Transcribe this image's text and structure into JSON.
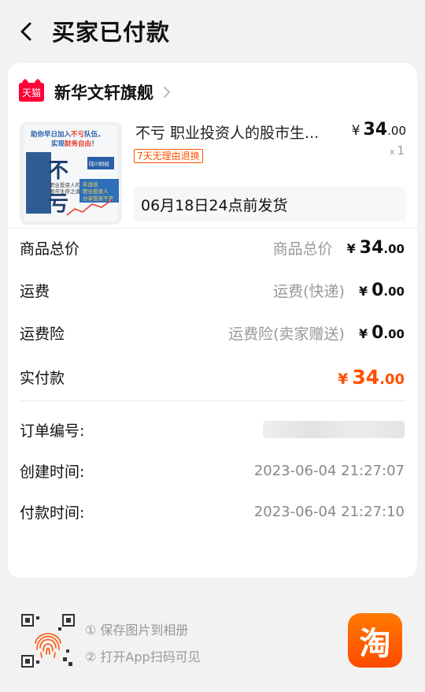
{
  "header": {
    "title": "买家已付款"
  },
  "shop": {
    "badge": "天猫",
    "name": "新华文轩旗舰"
  },
  "product": {
    "title": "不亏 职业投资人的股市生...",
    "return_badge": "7天无理由退换",
    "price_int": "34",
    "price_dec": ".00",
    "currency": "¥",
    "qty_prefix": "x",
    "qty": "1",
    "ship_note": "06月18日24点前发货",
    "cover": {
      "slogan_1": "助你早日加入",
      "slogan_highlight": "不亏",
      "slogan_2": "队伍，",
      "slogan_3": "实现",
      "slogan_highlight2": "财务自由",
      "slogan_4": "！",
      "big_1": "不",
      "big_2": "亏",
      "subtitle_1": "职业投资人的",
      "subtitle_2": "股市生存之道",
      "tag": "陆川财经",
      "blue_1": "实战派",
      "blue_2": "职业投资人",
      "blue_3": "分享投资干货"
    }
  },
  "summary": [
    {
      "label": "商品总价",
      "sub": "商品总价",
      "int": "34",
      "dec": ".00"
    },
    {
      "label": "运费",
      "sub": "运费(快递)",
      "int": "0",
      "dec": ".00"
    },
    {
      "label": "运费险",
      "sub": "运费险(卖家赠送)",
      "int": "0",
      "dec": ".00"
    }
  ],
  "paid": {
    "label": "实付款",
    "int": "34",
    "dec": ".00"
  },
  "order": {
    "id_label": "订单编号:",
    "created_label": "创建时间:",
    "created_value": "2023-06-04 21:27:07",
    "paid_label": "付款时间:",
    "paid_value": "2023-06-04 21:27:10"
  },
  "footer": {
    "step1": "① 保存图片到相册",
    "step2": "② 打开App扫码可见",
    "logo_char": "淘"
  },
  "colors": {
    "accent": "#ff5000",
    "tmall": "#ff0036",
    "bg": "#f2f2f2"
  }
}
